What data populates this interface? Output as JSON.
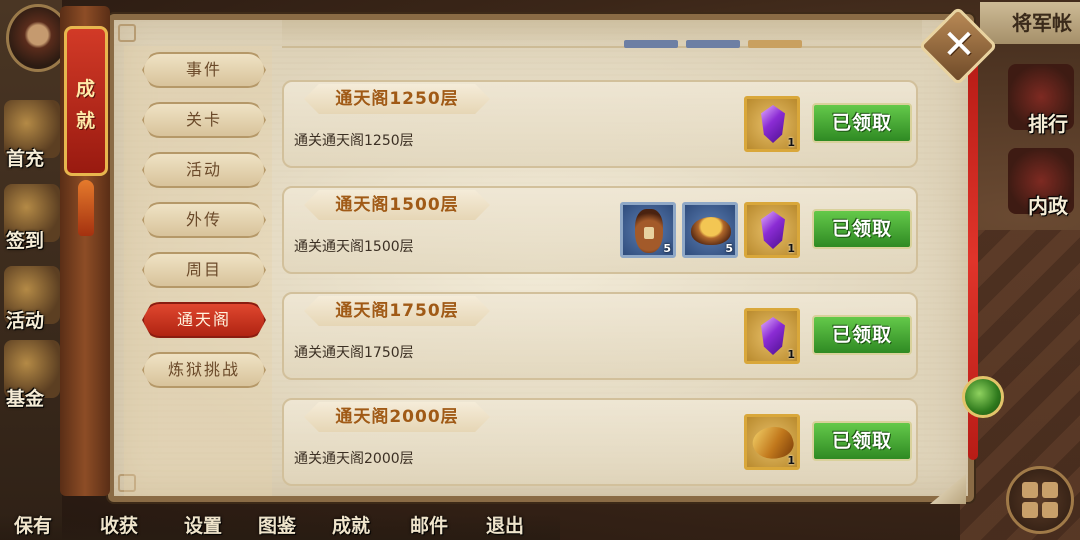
{
  "left_hud": {
    "items": [
      "首充",
      "签到",
      "活动",
      "基金"
    ]
  },
  "bottom_bar": [
    "保有",
    "收获",
    "设置",
    "图鉴",
    "成就",
    "邮件",
    "退出"
  ],
  "top_right_title": "将军帐",
  "right_hud": {
    "items": [
      "排行",
      "内政"
    ]
  },
  "panel": {
    "ribbon_chars": [
      "成",
      "就"
    ],
    "close_glyph": "✕",
    "tabs": [
      {
        "label": "事件",
        "active": false
      },
      {
        "label": "关卡",
        "active": false
      },
      {
        "label": "活动",
        "active": false
      },
      {
        "label": "外传",
        "active": false
      },
      {
        "label": "周目",
        "active": false
      },
      {
        "label": "通天阁",
        "active": true
      },
      {
        "label": "炼狱挑战",
        "active": false
      }
    ],
    "achievements": [
      {
        "title": "通天阁1250层",
        "desc": "通关通天阁1250层",
        "rewards": [
          {
            "icon": "purple-gem-icon",
            "count": "1"
          }
        ],
        "button": "已领取"
      },
      {
        "title": "通天阁1500层",
        "desc": "通关通天阁1500层",
        "rewards": [
          {
            "icon": "wine-jar-icon",
            "count": "5"
          },
          {
            "icon": "food-bowl-icon",
            "count": "5"
          },
          {
            "icon": "purple-gem-icon",
            "count": "1"
          }
        ],
        "button": "已领取"
      },
      {
        "title": "通天阁1750层",
        "desc": "通关通天阁1750层",
        "rewards": [
          {
            "icon": "purple-gem-icon",
            "count": "1"
          }
        ],
        "button": "已领取"
      },
      {
        "title": "通天阁2000层",
        "desc": "通关通天阁2000层",
        "rewards": [
          {
            "icon": "gold-scroll-icon",
            "count": "1"
          }
        ],
        "button": "已领取"
      }
    ]
  },
  "colors": {
    "claimed_button": "#3fa02f",
    "active_tab": "#c8321d",
    "title_text": "#a05a16"
  }
}
